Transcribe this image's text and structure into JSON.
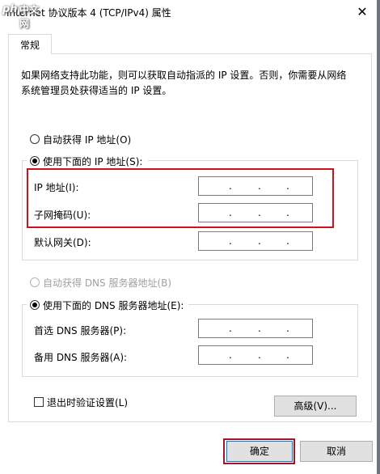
{
  "window": {
    "title": "Internet 协议版本 4 (TCP/IPv4) 属性",
    "close_glyph": "✕"
  },
  "logo": {
    "php": "php",
    "cn": "中文网"
  },
  "tabs": [
    {
      "label": "常规",
      "active": true
    }
  ],
  "description": "如果网络支持此功能，则可以获取自动指派的 IP 设置。否则，你需要从网络系统管理员处获得适当的 IP 设置。",
  "ip_mode": {
    "auto_label": "自动获得 IP 地址(O)",
    "manual_label": "使用下面的 IP 地址(S):",
    "selected": "manual"
  },
  "ip_fields": [
    {
      "label": "IP 地址(I):",
      "value": ". . ."
    },
    {
      "label": "子网掩码(U):",
      "value": ". . ."
    },
    {
      "label": "默认网关(D):",
      "value": ". . ."
    }
  ],
  "dns_mode": {
    "auto_label": "自动获得 DNS 服务器地址(B)",
    "manual_label": "使用下面的 DNS 服务器地址(E):",
    "selected": "manual",
    "auto_disabled": true
  },
  "dns_fields": [
    {
      "label": "首选 DNS 服务器(P):",
      "value": ". . ."
    },
    {
      "label": "备用 DNS 服务器(A):",
      "value": ". . ."
    }
  ],
  "validate_on_exit": {
    "label": "退出时验证设置(L)",
    "checked": false
  },
  "buttons": {
    "advanced": "高级(V)...",
    "ok": "确定",
    "cancel": "取消"
  },
  "colors": {
    "highlight": "#d0111b",
    "ok_border": "#a4132b"
  }
}
